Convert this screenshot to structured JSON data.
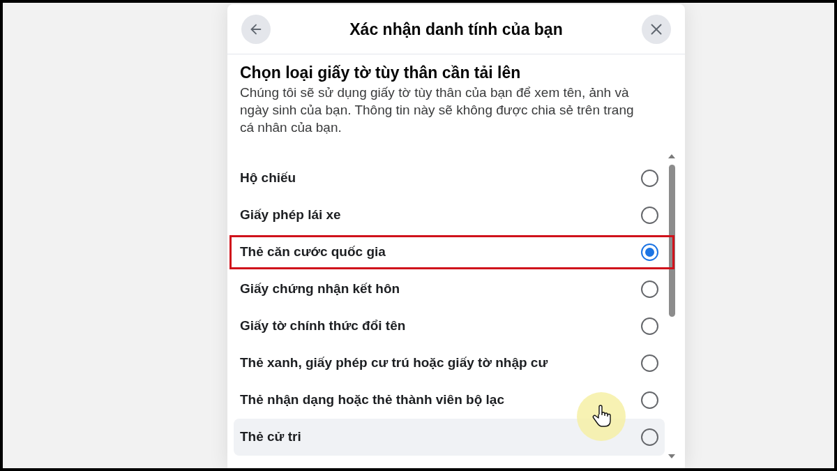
{
  "dialog": {
    "title": "Xác nhận danh tính của bạn",
    "heading": "Chọn loại giấy tờ tùy thân cần tải lên",
    "description": "Chúng tôi sẽ sử dụng giấy tờ tùy thân của bạn để xem tên, ảnh và ngày sinh của bạn. Thông tin này sẽ không được chia sẻ trên trang cá nhân của bạn.",
    "options": [
      {
        "label": "Hộ chiếu",
        "selected": false,
        "highlighted": false,
        "hovered": false
      },
      {
        "label": "Giấy phép lái xe",
        "selected": false,
        "highlighted": false,
        "hovered": false
      },
      {
        "label": "Thẻ căn cước quốc gia",
        "selected": true,
        "highlighted": true,
        "hovered": false
      },
      {
        "label": "Giấy chứng nhận kết hôn",
        "selected": false,
        "highlighted": false,
        "hovered": false
      },
      {
        "label": "Giấy tờ chính thức đổi tên",
        "selected": false,
        "highlighted": false,
        "hovered": false
      },
      {
        "label": "Thẻ xanh, giấy phép cư trú hoặc giấy tờ nhập cư",
        "selected": false,
        "highlighted": false,
        "hovered": false
      },
      {
        "label": "Thẻ nhận dạng hoặc thẻ thành viên bộ lạc",
        "selected": false,
        "highlighted": false,
        "hovered": false
      },
      {
        "label": "Thẻ cử tri",
        "selected": false,
        "highlighted": false,
        "hovered": true
      }
    ]
  }
}
